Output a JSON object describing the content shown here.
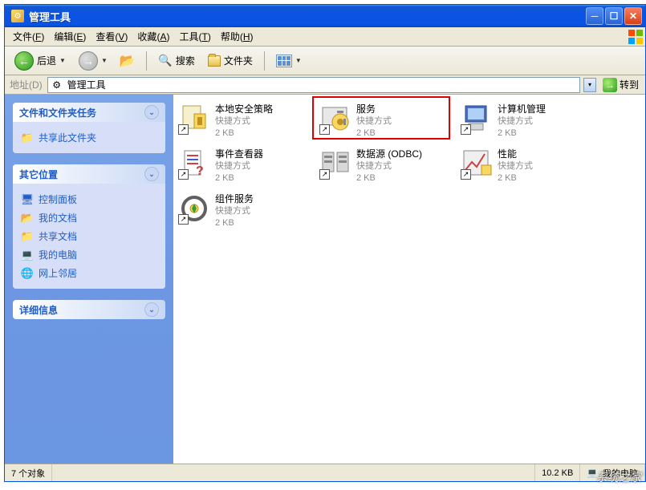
{
  "window": {
    "title": "管理工具",
    "icon_glyph": "⚙"
  },
  "menubar": {
    "items": [
      {
        "label": "文件",
        "accel": "F"
      },
      {
        "label": "编辑",
        "accel": "E"
      },
      {
        "label": "查看",
        "accel": "V"
      },
      {
        "label": "收藏",
        "accel": "A"
      },
      {
        "label": "工具",
        "accel": "T"
      },
      {
        "label": "帮助",
        "accel": "H"
      }
    ]
  },
  "toolbar": {
    "back_label": "后退",
    "search_label": "搜索",
    "folders_label": "文件夹"
  },
  "addressbar": {
    "label": "地址(D)",
    "value": "管理工具",
    "go_label": "转到"
  },
  "sidebar": {
    "panels": [
      {
        "title": "文件和文件夹任务",
        "links": [
          {
            "label": "共享此文件夹",
            "icon": "📁"
          }
        ]
      },
      {
        "title": "其它位置",
        "links": [
          {
            "label": "控制面板",
            "icon": "🖥"
          },
          {
            "label": "我的文档",
            "icon": "📂"
          },
          {
            "label": "共享文档",
            "icon": "📁"
          },
          {
            "label": "我的电脑",
            "icon": "💻"
          },
          {
            "label": "网上邻居",
            "icon": "🌐"
          }
        ]
      },
      {
        "title": "详细信息",
        "links": []
      }
    ]
  },
  "content": {
    "items": [
      {
        "name": "本地安全策略",
        "type": "快捷方式",
        "size": "2 KB"
      },
      {
        "name": "服务",
        "type": "快捷方式",
        "size": "2 KB",
        "highlighted": true
      },
      {
        "name": "计算机管理",
        "type": "快捷方式",
        "size": "2 KB"
      },
      {
        "name": "事件查看器",
        "type": "快捷方式",
        "size": "2 KB"
      },
      {
        "name": "数据源 (ODBC)",
        "type": "快捷方式",
        "size": "2 KB"
      },
      {
        "name": "性能",
        "type": "快捷方式",
        "size": "2 KB"
      },
      {
        "name": "组件服务",
        "type": "快捷方式",
        "size": "2 KB"
      }
    ]
  },
  "statusbar": {
    "object_count": "7 个对象",
    "size": "10.2 KB",
    "zone": "我的电脑"
  },
  "watermark": "系统之家"
}
